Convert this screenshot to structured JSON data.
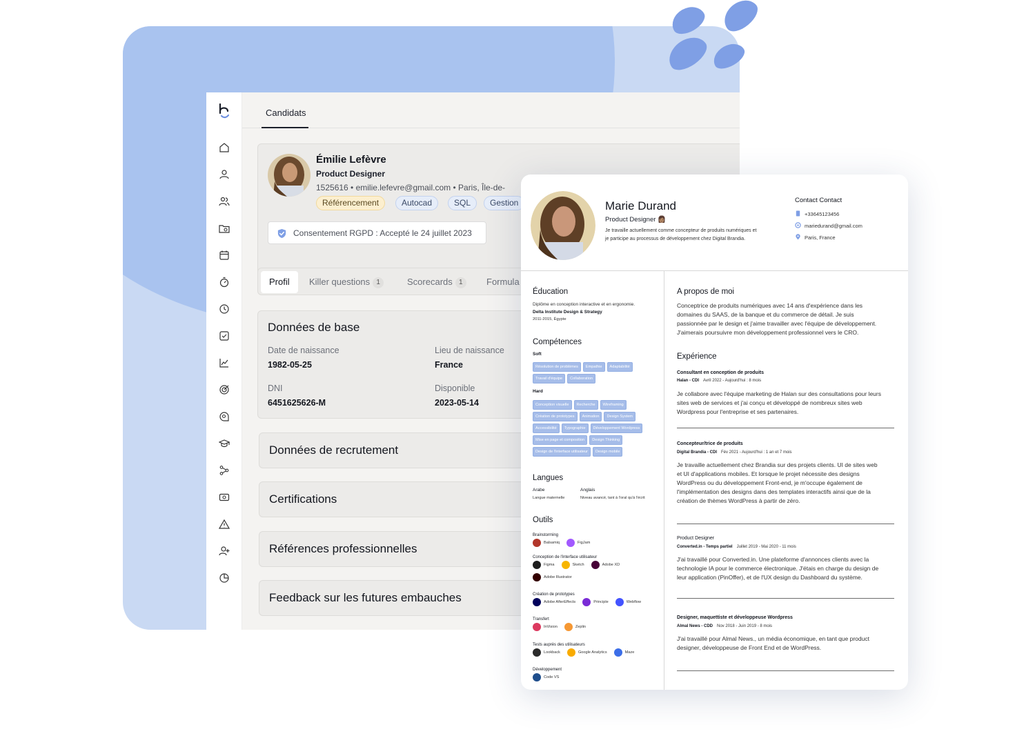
{
  "app": {
    "tab_candidats": "Candidats",
    "candidate": {
      "name": "Émilie Lefèvre",
      "role": "Product Designer",
      "meta": "1525616  •  emilie.lefevre@gmail.com  •  Paris, Île-de-",
      "tags": [
        "Référencement",
        "Autocad",
        "SQL",
        "Gestion"
      ],
      "consent": "Consentement RGPD : Accepté le 24 juillet 2023"
    },
    "profile_tabs": [
      {
        "label": "Profil",
        "count": ""
      },
      {
        "label": "Killer questions",
        "count": "1"
      },
      {
        "label": "Scorecards",
        "count": "1"
      },
      {
        "label": "Formula",
        "count": ""
      }
    ],
    "base_data": {
      "title": "Données de base",
      "birth_date_label": "Date de naissance",
      "birth_date": "1982-05-25",
      "birth_place_label": "Lieu de naissance",
      "birth_place": "France",
      "dni_label": "DNI",
      "dni": "6451625626-M",
      "available_label": "Disponible",
      "available": "2023-05-14"
    },
    "sections": [
      "Données de recrutement",
      "Certifications",
      "Références professionnelles",
      "Feedback sur les futures embauches"
    ],
    "sidebar_icons": [
      "home-icon",
      "user-icon",
      "users-icon",
      "folder-user-icon",
      "calendar-icon",
      "stopwatch-icon",
      "clock-icon",
      "checkbox-icon",
      "chart-icon",
      "target-icon",
      "chat-search-icon",
      "graduation-cap-icon",
      "workflow-icon",
      "money-icon",
      "alert-icon",
      "user-plus-icon",
      "pie-chart-icon"
    ]
  },
  "cv": {
    "name": "Marie Durand",
    "role": "Product Designer 👩🏽",
    "summary": "Je travaille actuellement comme concepteur de produits numériques et je participe au processus de développement chez Digital Brandia.",
    "contact_title": "Contact Contact",
    "phone": "+33645123456",
    "email": "mariedurand@gmail.com",
    "location": "Paris, France",
    "education": {
      "title": "Éducation",
      "degree": "Diplôme en conception interactive et en ergonomie.",
      "school": "Delta Institute Design & Strategy",
      "dates": "2011-2015, Égypte"
    },
    "skills": {
      "title": "Compétences",
      "soft_label": "Soft",
      "soft": [
        "Résolution de problèmes",
        "Empathie",
        "Adaptabilité",
        "Travail d'équipe",
        "Collaboration"
      ],
      "hard_label": "Hard",
      "hard": [
        "Conception visuelle",
        "Recherche",
        "Wireframing",
        "Création de prototypes",
        "Animation",
        "Design System",
        "Accessibilité",
        "Typographie",
        "Développement Wordpress",
        "Mise en page et composition",
        "Design Thinking",
        "Design de l'interface utilisateur",
        "Design mobile"
      ]
    },
    "languages": {
      "title": "Langues",
      "items": [
        {
          "name": "Arabe",
          "level": "Langue maternelle"
        },
        {
          "name": "Anglais",
          "level": "Niveau avancé, tant à l'oral qu'à l'écrit"
        }
      ]
    },
    "tools": {
      "title": "Outils",
      "groups": [
        {
          "label": "Brainstorming",
          "items": [
            {
              "name": "Balsamiq",
              "color": "#b2362a"
            },
            {
              "name": "FigJam",
              "color": "#a259ff"
            }
          ]
        },
        {
          "label": "Conception de l'interface utilisateur",
          "items": [
            {
              "name": "Figma",
              "color": "#1e1e1e"
            },
            {
              "name": "Sketch",
              "color": "#f7b500"
            },
            {
              "name": "Adobe XD",
              "color": "#470137"
            },
            {
              "name": "Adobe Illustrator",
              "color": "#330000"
            }
          ]
        },
        {
          "label": "Création de prototypes",
          "items": [
            {
              "name": "Adobe AfterEffects",
              "color": "#00005b"
            },
            {
              "name": "Principle",
              "color": "#7a2bd6"
            },
            {
              "name": "Webflow",
              "color": "#4353ff"
            }
          ]
        },
        {
          "label": "Transfert",
          "items": [
            {
              "name": "InVision",
              "color": "#dc395f"
            },
            {
              "name": "Zeplin",
              "color": "#f69833"
            }
          ]
        },
        {
          "label": "Tests auprès des utilisateurs",
          "items": [
            {
              "name": "Lookback",
              "color": "#2b2b2b"
            },
            {
              "name": "Google Analytics",
              "color": "#f9ab00"
            },
            {
              "name": "Maze",
              "color": "#3c6ee8"
            }
          ]
        },
        {
          "label": "Développement",
          "items": [
            {
              "name": "Code VS",
              "color": "#1f4e8c"
            }
          ]
        }
      ]
    },
    "about": {
      "title": "A propos de moi",
      "text": "Conceptrice de produits numériques avec 14 ans d'expérience dans les domaines du SAAS, de la banque et du commerce de détail. Je suis passionnée par le design et j'aime travailler avec l'équipe de développement. J'aimerais poursuivre mon développement professionnel vers le CRO."
    },
    "experience": {
      "title": "Expérience",
      "jobs": [
        {
          "title": "Consultant en conception de produits",
          "company": "Halan - CDI",
          "dates": "Avril 2022 - Aujourd'hui : 8 mois",
          "text": "Je collabore avec l'équipe marketing de Halan sur des consultations pour leurs sites web de services et j'ai conçu et développé de nombreux sites web Wordpress pour l'entreprise et ses partenaires."
        },
        {
          "title": "Concepteur/trice de produits",
          "company": "Digital Brandia - CDI",
          "dates": "Fév 2021 - Aujourd'hui : 1 an et 7 mois",
          "text": "Je travaille actuellement chez Brandia sur des projets clients. UI de sites web et UI d'applications mobiles. Et lorsque le projet nécessite des designs WordPress ou du développement Front-end, je m'occupe également de l'implémentation des designs dans des templates interactifs ainsi que de la création de thèmes WordPress à partir de zéro."
        },
        {
          "title": "Product Designer",
          "company": "Converted.in - Temps partiel",
          "dates": "Juillet 2019 - Mai 2020 - 11 mois",
          "text": "J'ai travaillé pour Converted.in. Une plateforme d'annonces clients avec la technologie IA pour le commerce électronique. J'étais en charge du design de leur application (PinOffer), et de l'UX design du Dashboard du système."
        },
        {
          "title": "Designer, maquettiste et développeuse Wordpress",
          "company": "Almal News - CDD",
          "dates": "Nov 2018 - Juin 2019 - 8 mois",
          "text": "J'ai travaillé pour Almal News., un média économique, en tant que product designer, développeuse de Front End et de WordPress."
        }
      ]
    }
  }
}
